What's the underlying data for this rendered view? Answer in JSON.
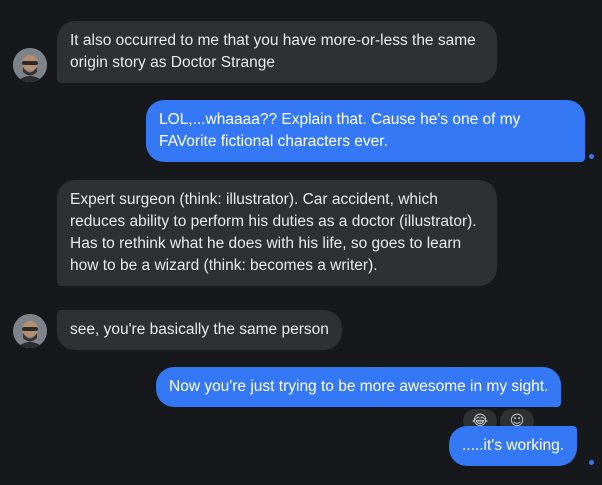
{
  "messages": [
    {
      "direction": "incoming",
      "text": "It also occurred to me that you have more-or-less the same origin story as Doctor Strange"
    },
    {
      "direction": "outgoing",
      "text": "LOL,...whaaaa?? Explain that. Cause he's one of my FAVorite fictional characters ever."
    },
    {
      "direction": "incoming",
      "text": "Expert surgeon (think: illustrator). Car accident, which reduces ability to perform his duties as a doctor (illustrator). Has to rethink what he does with his life, so goes to learn how to be a wizard (think: becomes a writer)."
    },
    {
      "direction": "incoming",
      "text": "see, you're basically the same person"
    },
    {
      "direction": "outgoing",
      "text": "Now you're just trying to be more awesome in my sight."
    },
    {
      "direction": "outgoing",
      "text": ".....it's working."
    }
  ],
  "reactions": [
    {
      "icon": "laughing-emoji",
      "glyph": "😂"
    },
    {
      "icon": "add-reaction-icon",
      "glyph": "☺"
    }
  ],
  "colors": {
    "background": "#17181c",
    "incoming_bubble": "#2f3033",
    "outgoing_bubble": "#3478f6"
  }
}
